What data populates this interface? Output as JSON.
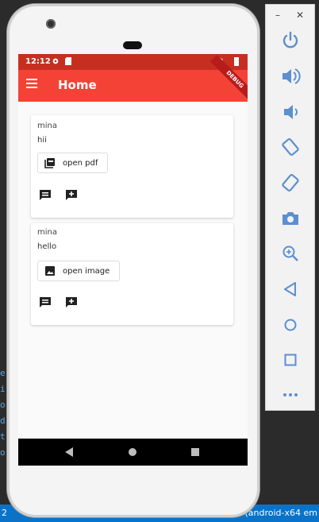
{
  "ide": {
    "left_fragments": [
      "e",
      "i",
      "o",
      "d",
      "t",
      "o"
    ],
    "status_left": "2",
    "status_right": "28 (android-x64 em"
  },
  "status_bar": {
    "time": "12:12"
  },
  "app_bar": {
    "title": "Home",
    "debug_banner": "DEBUG"
  },
  "posts": [
    {
      "author": "mina",
      "message": "hii",
      "attachment_label": "open pdf",
      "attachment_icon": "pdf-icon"
    },
    {
      "author": "mina",
      "message": "hello",
      "attachment_label": "open image",
      "attachment_icon": "image-icon"
    }
  ],
  "colors": {
    "appbar": "#f44336",
    "statusbar": "#c62f20",
    "emulator_icon": "#5b8fd0"
  },
  "emulator_controls": [
    "power-icon",
    "volume-up-icon",
    "volume-down-icon",
    "rotate-left-icon",
    "rotate-right-icon",
    "camera-icon",
    "zoom-icon",
    "back-icon",
    "home-icon",
    "overview-icon",
    "more-icon"
  ]
}
